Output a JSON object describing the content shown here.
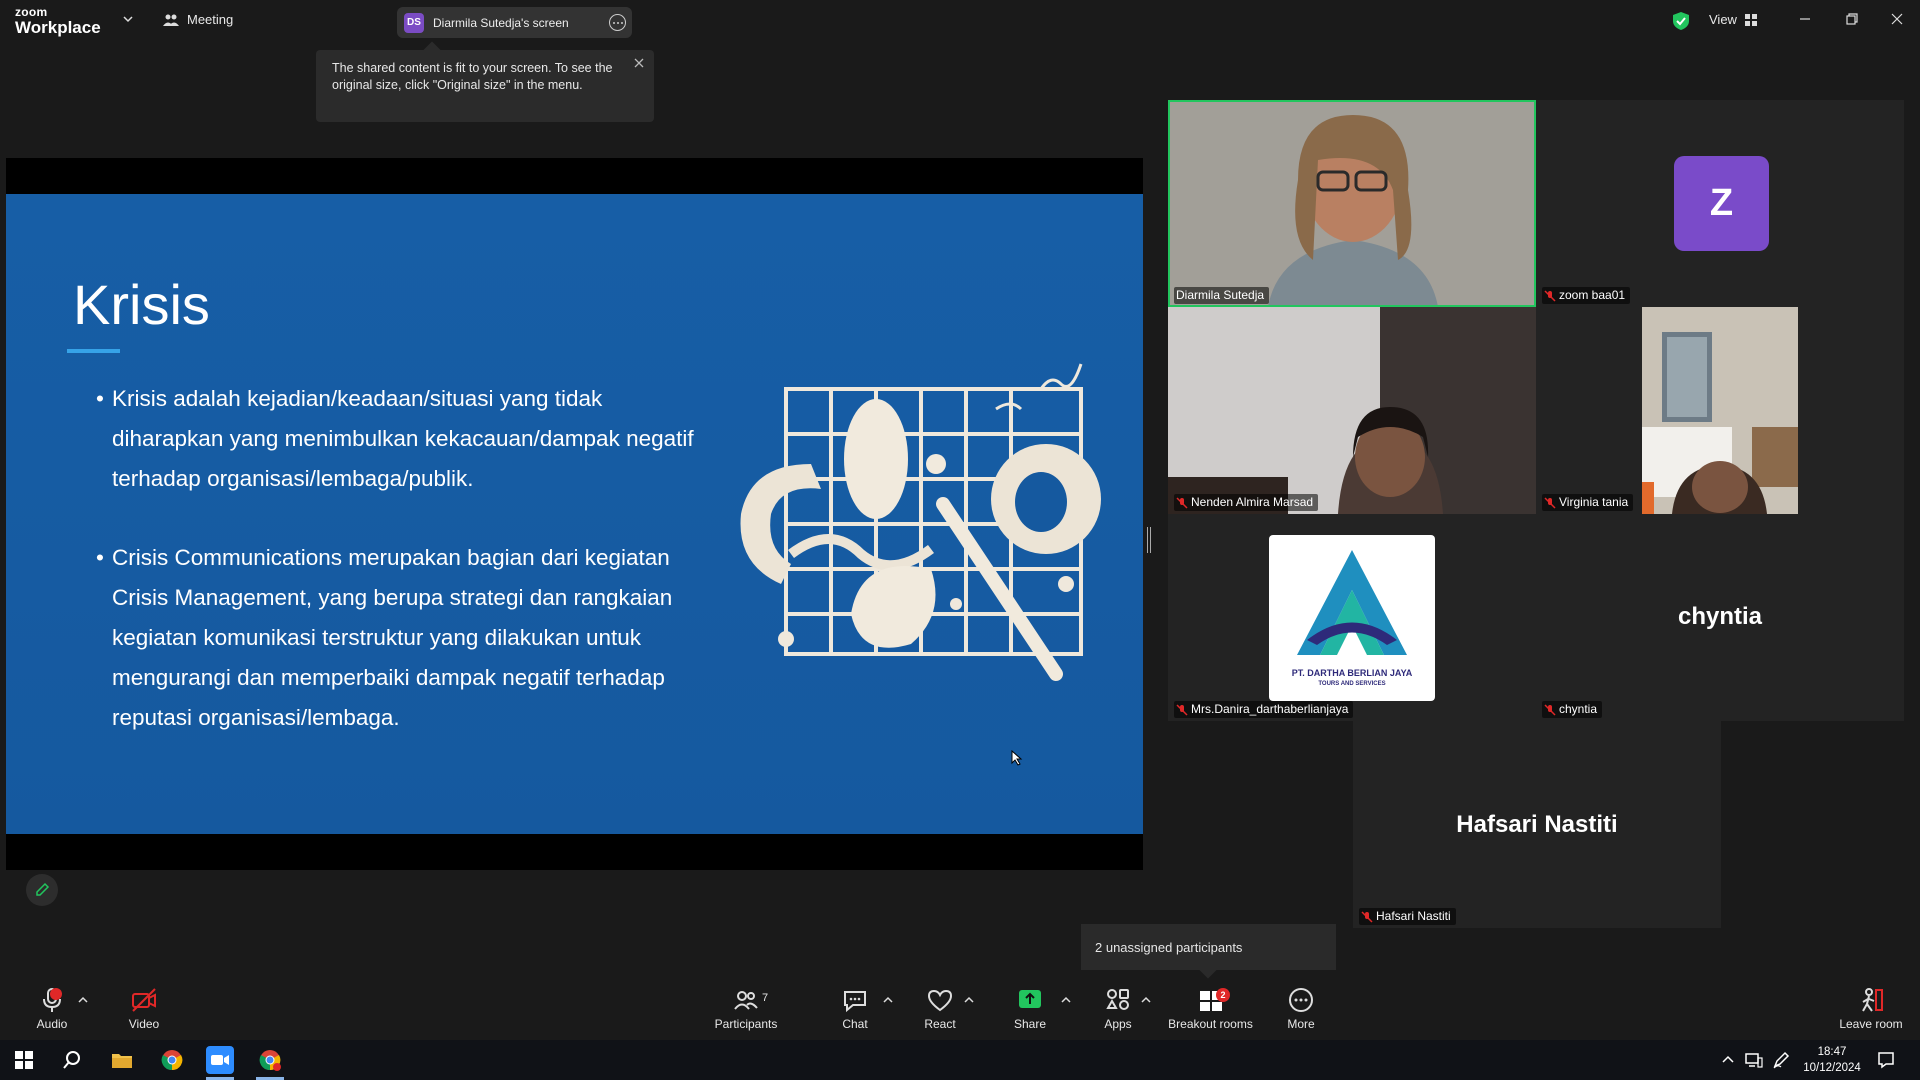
{
  "topbar": {
    "brand_small": "zoom",
    "brand_main": "Workplace",
    "meeting_label": "Meeting",
    "screen_badge": "DS",
    "screen_title": "Diarmila Sutedja's screen",
    "view_label": "View"
  },
  "tooltip": {
    "text": "The shared content is fit to your screen. To see the original size, click \"Original size\" in the menu."
  },
  "slide": {
    "title": "Krisis",
    "bullets": [
      "Krisis adalah kejadian/keadaan/situasi yang tidak diharapkan yang menimbulkan kekacauan/dampak negatif terhadap organisasi/lembaga/publik.",
      "Crisis Communications merupakan bagian dari kegiatan Crisis Management, yang berupa strategi dan rangkaian kegiatan komunikasi terstruktur yang dilakukan untuk mengurangi  dan memperbaiki dampak negatif terhadap reputasi organisasi/lembaga."
    ]
  },
  "gallery": {
    "participants": [
      {
        "name": "Diarmila Sutedja",
        "muted": false,
        "active": true
      },
      {
        "name": "zoom baa01",
        "muted": true,
        "avatar": "Z"
      },
      {
        "name": "Nenden Almira Marsad",
        "muted": true
      },
      {
        "name": "Virginia tania",
        "muted": true
      },
      {
        "name": "Mrs.Danira_darthaberlianjaya",
        "muted": true,
        "logo_text": "PT. DARTHA BERLIAN JAYA",
        "logo_sub": "TOURS AND SERVICES"
      },
      {
        "name": "chyntia",
        "muted": true,
        "big_name": "chyntia"
      },
      {
        "name": "Hafsari Nastiti",
        "muted": true,
        "big_name": "Hafsari Nastiti"
      }
    ]
  },
  "unassigned": {
    "text": "2 unassigned participants"
  },
  "toolbar": {
    "audio": "Audio",
    "video": "Video",
    "participants": "Participants",
    "participants_count": "7",
    "chat": "Chat",
    "react": "React",
    "share": "Share",
    "apps": "Apps",
    "breakout": "Breakout rooms",
    "breakout_badge": "2",
    "more": "More",
    "leave": "Leave room"
  },
  "taskbar": {
    "time": "18:47",
    "date": "10/12/2024"
  },
  "colors": {
    "active_border": "#22c55e",
    "slide_bg": "#175ea6",
    "accent_underline": "#36a3e8",
    "avatar_purple": "#7a4bc9",
    "muted_red": "#e02828",
    "share_green": "#22c55e"
  }
}
